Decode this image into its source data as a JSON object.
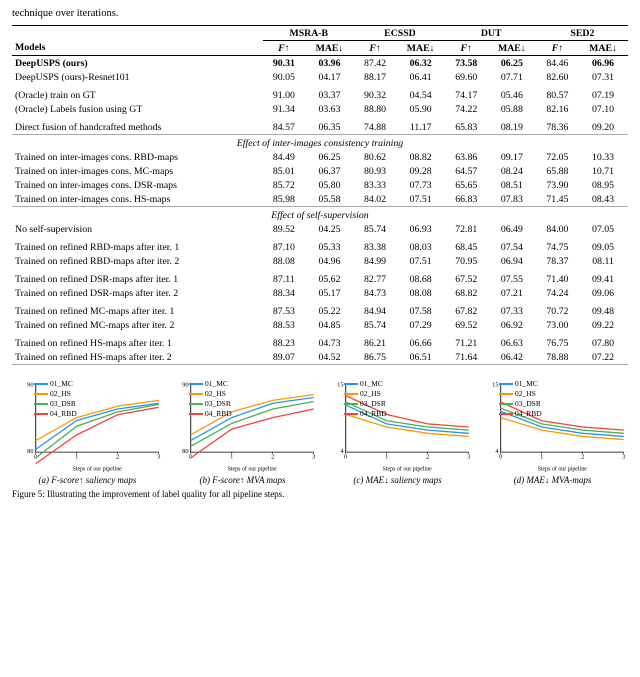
{
  "intro": {
    "text": "technique over iterations."
  },
  "table": {
    "col_groups": [
      {
        "label": "MSRA-B",
        "cols": [
          "F↑",
          "MAE↓"
        ]
      },
      {
        "label": "ECSSD",
        "cols": [
          "F↑",
          "MAE↓"
        ]
      },
      {
        "label": "DUT",
        "cols": [
          "F↑",
          "MAE↓"
        ]
      },
      {
        "label": "SED2",
        "cols": [
          "F↑",
          "MAE↓"
        ]
      }
    ],
    "model_col": "Models",
    "rows": [
      {
        "type": "data",
        "bold": true,
        "first": true,
        "model": "DeepUSPS (ours)",
        "values": [
          "90.31",
          "03.96",
          "87.42",
          "06.32",
          "73.58",
          "06.25",
          "84.46",
          "06.96"
        ],
        "bold_vals": [
          true,
          true,
          false,
          true,
          true,
          true,
          false,
          true
        ]
      },
      {
        "type": "data",
        "model": "DeepUSPS (ours)-Resnet101",
        "values": [
          "90.05",
          "04.17",
          "88.17",
          "06.41",
          "69.60",
          "07.71",
          "82.60",
          "07.31"
        ],
        "bold_vals": [
          false,
          false,
          false,
          false,
          false,
          false,
          false,
          false
        ]
      },
      {
        "type": "separator"
      },
      {
        "type": "data",
        "model": "(Oracle) train on GT",
        "values": [
          "91.00",
          "03.37",
          "90.32",
          "04.54",
          "74.17",
          "05.46",
          "80.57",
          "07.19"
        ],
        "bold_vals": [
          false,
          false,
          false,
          false,
          false,
          false,
          false,
          false
        ]
      },
      {
        "type": "data",
        "model": "(Oracle) Labels fusion using GT",
        "values": [
          "91.34",
          "03.63",
          "88.80",
          "05.90",
          "74.22",
          "05.88",
          "82.16",
          "07.10"
        ],
        "bold_vals": [
          false,
          false,
          false,
          false,
          false,
          false,
          false,
          false
        ]
      },
      {
        "type": "separator"
      },
      {
        "type": "data",
        "last": true,
        "model": "Direct fusion of handcrafted methods",
        "values": [
          "84.57",
          "06.35",
          "74.88",
          "11.17",
          "65.83",
          "08.19",
          "78.36",
          "09.20"
        ],
        "bold_vals": [
          false,
          false,
          false,
          false,
          false,
          false,
          false,
          false
        ]
      },
      {
        "type": "section",
        "label": "Effect of inter-images consistency training"
      },
      {
        "type": "data",
        "model": "Trained on inter-images cons. RBD-maps",
        "values": [
          "84.49",
          "06.25",
          "80.62",
          "08.82",
          "63.86",
          "09.17",
          "72.05",
          "10.33"
        ],
        "bold_vals": [
          false,
          false,
          false,
          false,
          false,
          false,
          false,
          false
        ]
      },
      {
        "type": "data",
        "model": "Trained on inter-images cons. MC-maps",
        "values": [
          "85.01",
          "06.37",
          "80.93",
          "09.28",
          "64.57",
          "08.24",
          "65.88",
          "10.71"
        ],
        "bold_vals": [
          false,
          false,
          false,
          false,
          false,
          false,
          false,
          false
        ]
      },
      {
        "type": "data",
        "model": "Trained on inter-images cons. DSR-maps",
        "values": [
          "85.72",
          "05.80",
          "83.33",
          "07.73",
          "65.65",
          "08.51",
          "73.90",
          "08.95"
        ],
        "bold_vals": [
          false,
          false,
          false,
          false,
          false,
          false,
          false,
          false
        ]
      },
      {
        "type": "data",
        "last": true,
        "model": "Trained on inter-images cons. HS-maps",
        "values": [
          "85.98",
          "05.58",
          "84.02",
          "07.51",
          "66.83",
          "07.83",
          "71.45",
          "08.43"
        ],
        "bold_vals": [
          false,
          false,
          false,
          false,
          false,
          false,
          false,
          false
        ]
      },
      {
        "type": "section",
        "label": "Effect of self-supervision"
      },
      {
        "type": "data",
        "model": "No self-supervision",
        "values": [
          "89.52",
          "04.25",
          "85.74",
          "06.93",
          "72.81",
          "06.49",
          "84.00",
          "07.05"
        ],
        "bold_vals": [
          false,
          false,
          false,
          false,
          false,
          false,
          false,
          false
        ]
      },
      {
        "type": "separator"
      },
      {
        "type": "data",
        "model": "Trained on refined RBD-maps after iter. 1",
        "values": [
          "87.10",
          "05.33",
          "83.38",
          "08.03",
          "68.45",
          "07.54",
          "74.75",
          "09.05"
        ],
        "bold_vals": [
          false,
          false,
          false,
          false,
          false,
          false,
          false,
          false
        ]
      },
      {
        "type": "data",
        "model": "Trained on refined RBD-maps after iter. 2",
        "values": [
          "88.08",
          "04.96",
          "84.99",
          "07.51",
          "70.95",
          "06.94",
          "78.37",
          "08.11"
        ],
        "bold_vals": [
          false,
          false,
          false,
          false,
          false,
          false,
          false,
          false
        ]
      },
      {
        "type": "separator"
      },
      {
        "type": "data",
        "model": "Trained on refined DSR-maps after iter. 1",
        "values": [
          "87.11",
          "05.62",
          "82.77",
          "08.68",
          "67.52",
          "07.55",
          "71.40",
          "09.41"
        ],
        "bold_vals": [
          false,
          false,
          false,
          false,
          false,
          false,
          false,
          false
        ]
      },
      {
        "type": "data",
        "model": "Trained on refined DSR-maps after iter. 2",
        "values": [
          "88.34",
          "05.17",
          "84.73",
          "08.08",
          "68.82",
          "07.21",
          "74.24",
          "09.06"
        ],
        "bold_vals": [
          false,
          false,
          false,
          false,
          false,
          false,
          false,
          false
        ]
      },
      {
        "type": "separator"
      },
      {
        "type": "data",
        "model": "Trained on refined MC-maps after iter. 1",
        "values": [
          "87.53",
          "05.22",
          "84.94",
          "07.58",
          "67.82",
          "07.33",
          "70.72",
          "09.48"
        ],
        "bold_vals": [
          false,
          false,
          false,
          false,
          false,
          false,
          false,
          false
        ]
      },
      {
        "type": "data",
        "model": "Trained on refined MC-maps after iter. 2",
        "values": [
          "88.53",
          "04.85",
          "85.74",
          "07.29",
          "69.52",
          "06.92",
          "73.00",
          "09.22"
        ],
        "bold_vals": [
          false,
          false,
          false,
          false,
          false,
          false,
          false,
          false
        ]
      },
      {
        "type": "separator"
      },
      {
        "type": "data",
        "model": "Trained on refined HS-maps after iter. 1",
        "values": [
          "88.23",
          "04.73",
          "86.21",
          "06.66",
          "71.21",
          "06.63",
          "76.75",
          "07.80"
        ],
        "bold_vals": [
          false,
          false,
          false,
          false,
          false,
          false,
          false,
          false
        ]
      },
      {
        "type": "data",
        "last": true,
        "model": "Trained on refined HS-maps after iter. 2",
        "values": [
          "89.07",
          "04.52",
          "86.75",
          "06.51",
          "71.64",
          "06.42",
          "78.88",
          "07.22"
        ],
        "bold_vals": [
          false,
          false,
          false,
          false,
          false,
          false,
          false,
          false
        ]
      }
    ]
  },
  "charts": [
    {
      "id": "chart-a",
      "caption": "(a) F-score↑ saliency maps",
      "y_label": "90",
      "y_min": 80,
      "y_max": 92,
      "x_ticks": [
        "0",
        "1",
        "2",
        "3"
      ],
      "x_label": "Steps of our pipeline",
      "legend": [
        {
          "label": "01_MC",
          "color": "#2196F3"
        },
        {
          "label": "02_HS",
          "color": "#FF9800"
        },
        {
          "label": "03_DSR",
          "color": "#4CAF50"
        },
        {
          "label": "04_RBD",
          "color": "#F44336"
        }
      ],
      "series": [
        {
          "name": "01_MC",
          "color": "#2196F3",
          "points": [
            80.5,
            85.5,
            87.5,
            88.5
          ]
        },
        {
          "name": "02_HS",
          "color": "#FF9800",
          "points": [
            82,
            86,
            88,
            89
          ]
        },
        {
          "name": "03_DSR",
          "color": "#4CAF50",
          "points": [
            79,
            84.5,
            87,
            88.3
          ]
        },
        {
          "name": "04_RBD",
          "color": "#F44336",
          "points": [
            78,
            83,
            86.5,
            87.8
          ]
        }
      ]
    },
    {
      "id": "chart-b",
      "caption": "(b) F-score↑ MVA maps",
      "y_label": "90",
      "y_min": 80,
      "y_max": 92,
      "x_ticks": [
        "0",
        "1",
        "2",
        "3"
      ],
      "x_label": "Steps of our pipeline",
      "legend": [
        {
          "label": "01_MC",
          "color": "#2196F3"
        },
        {
          "label": "02_HS",
          "color": "#FF9800"
        },
        {
          "label": "03_DSR",
          "color": "#4CAF50"
        },
        {
          "label": "04_RBD",
          "color": "#F44336"
        }
      ],
      "series": [
        {
          "name": "01_MC",
          "color": "#2196F3",
          "points": [
            82,
            86,
            88.5,
            89.5
          ]
        },
        {
          "name": "02_HS",
          "color": "#FF9800",
          "points": [
            83,
            87,
            89,
            90
          ]
        },
        {
          "name": "03_DSR",
          "color": "#4CAF50",
          "points": [
            81,
            85,
            87.5,
            88.8
          ]
        },
        {
          "name": "04_RBD",
          "color": "#F44336",
          "points": [
            79,
            84,
            86,
            87.5
          ]
        }
      ]
    },
    {
      "id": "chart-c",
      "caption": "(c) MAE↓ saliency maps",
      "y_label": "15",
      "y_min": 4,
      "y_max": 15,
      "x_ticks": [
        "0",
        "1",
        "2",
        "3"
      ],
      "x_label": "Steps of our pipeline",
      "legend": [
        {
          "label": "01_MC",
          "color": "#2196F3"
        },
        {
          "label": "02_HS",
          "color": "#FF9800"
        },
        {
          "label": "03_DSR",
          "color": "#4CAF50"
        },
        {
          "label": "04_RBD",
          "color": "#F44336"
        }
      ],
      "series": [
        {
          "name": "01_MC",
          "color": "#2196F3",
          "points": [
            11.5,
            8.5,
            7.5,
            7
          ]
        },
        {
          "name": "02_HS",
          "color": "#FF9800",
          "points": [
            10,
            8,
            7,
            6.5
          ]
        },
        {
          "name": "03_DSR",
          "color": "#4CAF50",
          "points": [
            12,
            9,
            8,
            7.5
          ]
        },
        {
          "name": "04_RBD",
          "color": "#F44336",
          "points": [
            13,
            10,
            8.5,
            8
          ]
        }
      ]
    },
    {
      "id": "chart-d",
      "caption": "(d) MAE↓ MVA-maps",
      "y_label": "15",
      "y_min": 4,
      "y_max": 15,
      "x_ticks": [
        "0",
        "1",
        "2",
        "3"
      ],
      "x_label": "Steps of our pipeline",
      "legend": [
        {
          "label": "01_MC",
          "color": "#2196F3"
        },
        {
          "label": "02_HS",
          "color": "#FF9800"
        },
        {
          "label": "03_DSR",
          "color": "#4CAF50"
        },
        {
          "label": "04_RBD",
          "color": "#F44336"
        }
      ],
      "series": [
        {
          "name": "01_MC",
          "color": "#2196F3",
          "points": [
            10.5,
            8,
            7,
            6.5
          ]
        },
        {
          "name": "02_HS",
          "color": "#FF9800",
          "points": [
            9.5,
            7.5,
            6.5,
            6
          ]
        },
        {
          "name": "03_DSR",
          "color": "#4CAF50",
          "points": [
            11,
            8.5,
            7.5,
            7
          ]
        },
        {
          "name": "04_RBD",
          "color": "#F44336",
          "points": [
            12,
            9,
            8,
            7.5
          ]
        }
      ]
    }
  ],
  "figure_caption": "Figure 5: Illustrating the improvement of label quality for all pipeline steps."
}
